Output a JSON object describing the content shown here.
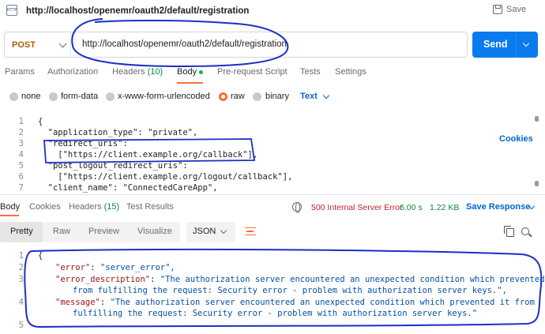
{
  "window": {
    "app_icon": "http-icon",
    "title": "http://localhost/openemr/oauth2/default/registration",
    "save_label": "Save"
  },
  "request": {
    "method": "POST",
    "url": "http://localhost/openemr/oauth2/default/registration",
    "send_label": "Send"
  },
  "request_tabs": {
    "params": "Params",
    "authorization": "Authorization",
    "headers": "Headers",
    "headers_count": "(10)",
    "body": "Body",
    "prerequest": "Pre-request Script",
    "tests": "Tests",
    "settings": "Settings",
    "cookies": "Cookies"
  },
  "body_types": {
    "none": "none",
    "form_data": "form-data",
    "urlencoded": "x-www-form-urlencoded",
    "raw": "raw",
    "binary": "binary",
    "format": "Text"
  },
  "request_body": {
    "lines": [
      {
        "n": "1",
        "text": "{"
      },
      {
        "n": "2",
        "text": "  \"application_type\": \"private\","
      },
      {
        "n": "3",
        "text": "  \"redirect_uris\":"
      },
      {
        "n": "4",
        "text": "    [\"https://client.example.org/callback\"],"
      },
      {
        "n": "5",
        "text": "  \"post_logout_redirect_uris\":"
      },
      {
        "n": "6",
        "text": "    [\"https://client.example.org/logout/callback\"],"
      },
      {
        "n": "7",
        "text": "  \"client_name\": \"ConnectedCareApp\","
      }
    ]
  },
  "response_tabs": {
    "body": "Body",
    "cookies": "Cookies",
    "headers": "Headers",
    "headers_count": "(15)",
    "test_results": "Test Results"
  },
  "response_status": {
    "globe_icon": "globe-icon",
    "code": "500 Internal Server Error",
    "time": "6.00 s",
    "size": "1.22 KB",
    "save_response": "Save Response"
  },
  "view_options": {
    "pretty": "Pretty",
    "raw": "Raw",
    "preview": "Preview",
    "visualize": "Visualize",
    "format": "JSON"
  },
  "response_body": {
    "l1": "{",
    "error_key": "\"error\"",
    "error_val": "\"server_error\",",
    "desc_key": "\"error_description\"",
    "desc_val_1": "\"The authorization server encountered an unexpected condition which prevented it",
    "desc_val_2": "from fulfilling the request: Security error - problem with authorization server keys.\",",
    "msg_key": "\"message\"",
    "msg_val_1": "\"The authorization server encountered an unexpected condition which prevented it from",
    "msg_val_2": "fulfilling the request: Security error - problem with authorization server keys.\"",
    "gutter": [
      "1",
      "2",
      "3",
      "4",
      "5"
    ]
  },
  "annotation_color": "#1b2fc6",
  "accent_orange": "#ff6c37",
  "primary_blue": "#097bed"
}
